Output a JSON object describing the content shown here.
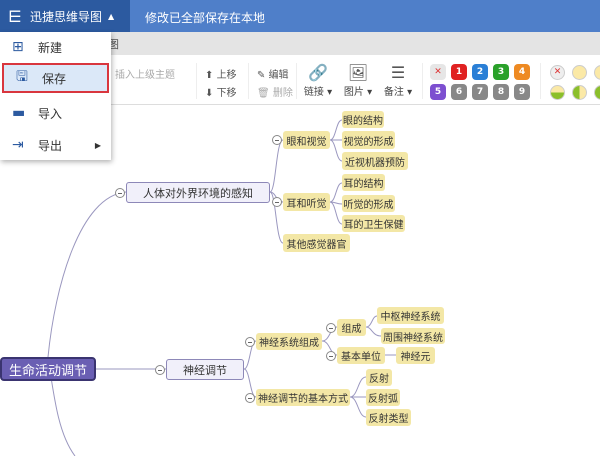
{
  "app": {
    "title": "迅捷思维导图",
    "status": "修改已全部保存在本地",
    "tab_fragment": "图"
  },
  "menu": {
    "items": [
      {
        "label": "新建",
        "icon": "new-file-icon"
      },
      {
        "label": "保存",
        "icon": "save-icon",
        "selected": true
      },
      {
        "label": "导入",
        "icon": "folder-icon"
      },
      {
        "label": "导出",
        "icon": "export-icon",
        "submenu": true
      }
    ]
  },
  "toolbar": {
    "insert_parent": "插入上级主题",
    "move_up": "上移",
    "move_down": "下移",
    "edit": "编辑",
    "delete": "删除",
    "link": "链接",
    "image": "图片",
    "note": "备注",
    "priority": [
      {
        "label": "✕",
        "color": "#e6e6e6"
      },
      {
        "label": "1",
        "color": "#e02222"
      },
      {
        "label": "2",
        "color": "#2a7fd6"
      },
      {
        "label": "3",
        "color": "#2aa12a"
      },
      {
        "label": "4",
        "color": "#ee8a22"
      },
      {
        "label": "5",
        "color": "#7d4fd0"
      },
      {
        "label": "6",
        "color": "#888888"
      },
      {
        "label": "7",
        "color": "#888888"
      },
      {
        "label": "8",
        "color": "#888888"
      },
      {
        "label": "9",
        "color": "#888888"
      }
    ],
    "progress_icons": [
      "clear",
      "0%",
      "0%",
      "25%",
      "37.5%",
      "50%"
    ]
  },
  "mindmap": {
    "root": "生命活动调节",
    "l1a": "人体对外界环境的感知",
    "eye": "眼和视觉",
    "eye1": "眼的结构",
    "eye2": "视觉的形成",
    "eye3": "近视机器预防",
    "ear": "耳和听觉",
    "ear1": "耳的结构",
    "ear2": "听觉的形成",
    "ear3": "耳的卫生保健",
    "other": "其他感觉器官",
    "l1b": "神经调节",
    "ns": "神经系统组成",
    "zc": "组成",
    "zs": "中枢神经系统",
    "zw": "周围神经系统",
    "jb": "基本单位",
    "sjy": "神经元",
    "fs": "神经调节的基本方式",
    "f1": "反射",
    "f2": "反射弧",
    "f3": "反射类型"
  }
}
